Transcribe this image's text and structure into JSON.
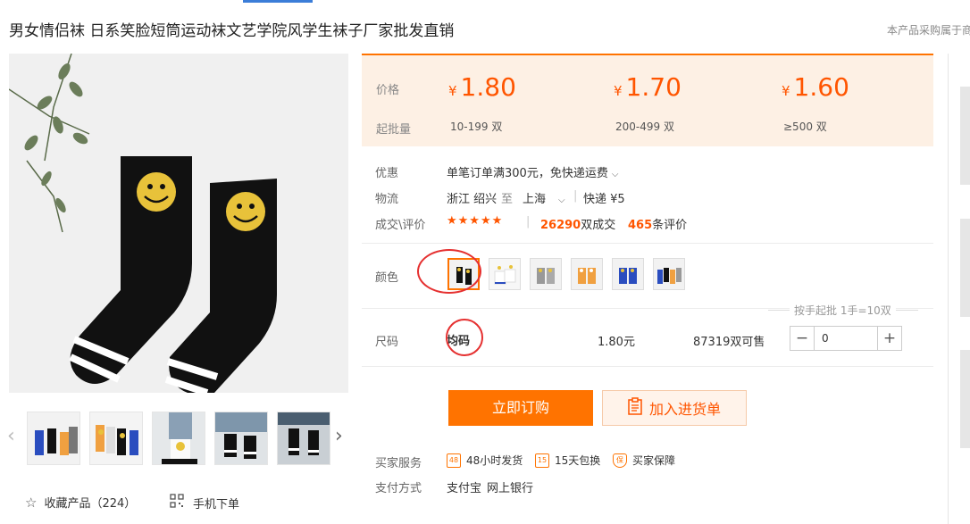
{
  "product": {
    "title": "男女情侣袜 日系笑脸短筒运动袜文艺学院风学生袜子厂家批发直销",
    "procurement_note": "本产品采购属于商"
  },
  "price_panel": {
    "price_label": "价格",
    "moq_label": "起批量",
    "currency_symbol": "¥",
    "tiers": [
      {
        "price": "1.80",
        "range": "10-199 双"
      },
      {
        "price": "1.70",
        "range": "200-499 双"
      },
      {
        "price": "1.60",
        "range": "≥500 双"
      }
    ]
  },
  "attributes": {
    "promo_label": "优惠",
    "promo_value": "单笔订单满300元，免快递运费",
    "logistics_label": "物流",
    "logistics_from": "浙江  绍兴",
    "logistics_to_word": "至",
    "logistics_to": "上海",
    "shipping_method": "快递 ¥5",
    "deals_label": "成交\\评价",
    "stars": "★★★★★",
    "deals_count": "26290",
    "deals_suffix": "双成交",
    "review_count": "465",
    "review_suffix": "条评价"
  },
  "color": {
    "label": "颜色",
    "options": [
      "black-yellow",
      "white-yellow",
      "gray-yellow",
      "orange-yellow",
      "blue-yellow",
      "mixed"
    ],
    "selected_index": 0
  },
  "size": {
    "label": "尺码",
    "value": "均码",
    "price": "1.80元",
    "stock": "87319双可售",
    "hint": "按手起批 1手=10双",
    "quantity": "0"
  },
  "actions": {
    "buy_now": "立即订购",
    "add_to_cart": "加入进货单"
  },
  "services": {
    "label": "买家服务",
    "items": [
      {
        "icon": "48h-shipping-icon",
        "badge": "48",
        "text": "48小时发货"
      },
      {
        "icon": "15day-exchange-icon",
        "badge": "15",
        "text": "15天包换"
      },
      {
        "icon": "buyer-protection-icon",
        "badge": "保",
        "text": "买家保障"
      }
    ],
    "payment_label": "支付方式",
    "payment_methods": [
      "支付宝",
      "网上银行"
    ]
  },
  "gallery": {
    "favorite_label": "收藏产品（224）",
    "mobile_label": "手机下单"
  },
  "colors": {
    "accent": "#ff7300",
    "price_text": "#ff5500",
    "price_panel_bg": "#fdf0e4",
    "annotation_red": "#e53030"
  }
}
